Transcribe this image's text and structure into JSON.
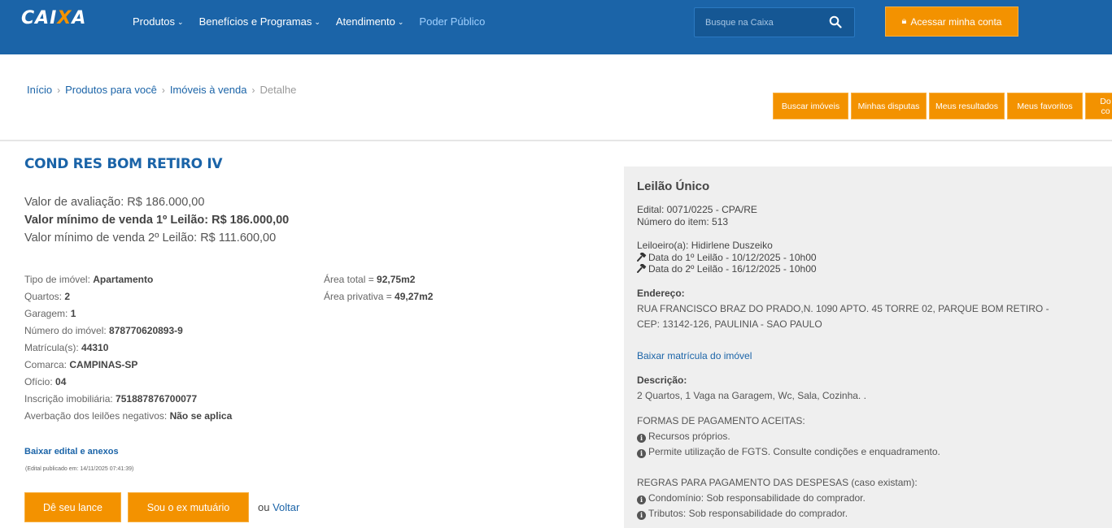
{
  "header": {
    "logo": {
      "prefix": "CAI",
      "x": "X",
      "suffix": "A"
    },
    "nav": [
      {
        "label": "Produtos",
        "dropdown": true
      },
      {
        "label": "Benefícios e Programas",
        "dropdown": true
      },
      {
        "label": "Atendimento",
        "dropdown": true
      },
      {
        "label": "Poder Público",
        "dropdown": false
      }
    ],
    "search_placeholder": "Busque na Caixa",
    "search_icon": "search-icon",
    "login_label": "Acessar minha conta",
    "login_icon": "lock-icon"
  },
  "breadcrumb": {
    "items": [
      "Início",
      "Produtos para você",
      "Imóveis à venda"
    ],
    "current": "Detalhe",
    "separator": "›"
  },
  "quick_buttons": [
    "Buscar imóveis",
    "Minhas disputas",
    "Meus resultados",
    "Meus favoritos",
    "Do co"
  ],
  "property": {
    "title": "COND RES BOM RETIRO IV",
    "valor_avaliacao": "Valor de avaliação: R$ 186.000,00",
    "valor_1_leilao": "Valor mínimo de venda 1º Leilão: R$ 186.000,00",
    "valor_2_leilao": "Valor mínimo de venda 2º Leilão: R$ 111.600,00",
    "specs_left": [
      {
        "label": "Tipo de imóvel: ",
        "value": "Apartamento"
      },
      {
        "label": "Quartos: ",
        "value": "2"
      },
      {
        "label": "Garagem: ",
        "value": "1"
      },
      {
        "label": "Número do imóvel: ",
        "value": "878770620893-9"
      },
      {
        "label": "Matrícula(s): ",
        "value": "44310"
      },
      {
        "label": "Comarca: ",
        "value": "CAMPINAS-SP"
      },
      {
        "label": "Ofício: ",
        "value": "04"
      },
      {
        "label": "Inscrição imobiliária: ",
        "value": "751887876700077"
      },
      {
        "label": "Averbação dos leilões negativos: ",
        "value": "Não se aplica"
      }
    ],
    "specs_right": [
      {
        "label": "Área total = ",
        "value": "92,75m2"
      },
      {
        "label": "Área privativa = ",
        "value": "49,27m2"
      }
    ],
    "edital_link": "Baixar edital e anexos",
    "edital_date": "(Edital publicado em: 14/11/2025 07:41:39)",
    "bid_button": "Dê seu lance",
    "ex_mutuario_button": "Sou o ex mutuário",
    "or_text": "ou ",
    "back_link": "Voltar"
  },
  "panel": {
    "title": "Leilão Único",
    "edital": "Edital: 0071/0225 - CPA/RE",
    "numero_item": "Número do item: 513",
    "leiloeiro": "Leiloeiro(a): Hidirlene Duszeiko",
    "data_1": "Data do 1º Leilão - 10/12/2025 - 10h00",
    "data_2": "Data do 2º Leilão - 16/12/2025 - 10h00",
    "endereco_label": "Endereço:",
    "endereco_1": "RUA FRANCISCO BRAZ DO PRADO,N. 1090 APTO. 45 TORRE 02, PARQUE BOM RETIRO -",
    "endereco_2": "CEP: 13142-126, PAULINIA - SAO PAULO",
    "matricula_link": "Baixar matrícula do imóvel",
    "descricao_label": "Descrição:",
    "descricao": "2 Quartos, 1 Vaga na Garagem, Wc, Sala, Cozinha. .",
    "formas_title": "FORMAS DE PAGAMENTO ACEITAS:",
    "formas": [
      "Recursos próprios.",
      "Permite utilização de FGTS. Consulte condições e enquadramento."
    ],
    "regras_title": "REGRAS PARA PAGAMENTO DAS DESPESAS (caso existam):",
    "regras": [
      "Condomínio: Sob responsabilidade do comprador.",
      "Tributos: Sob responsabilidade do comprador."
    ]
  },
  "colors": {
    "brand_blue": "#1b64a8",
    "accent_orange": "#f39200",
    "panel_bg": "#efefef"
  }
}
